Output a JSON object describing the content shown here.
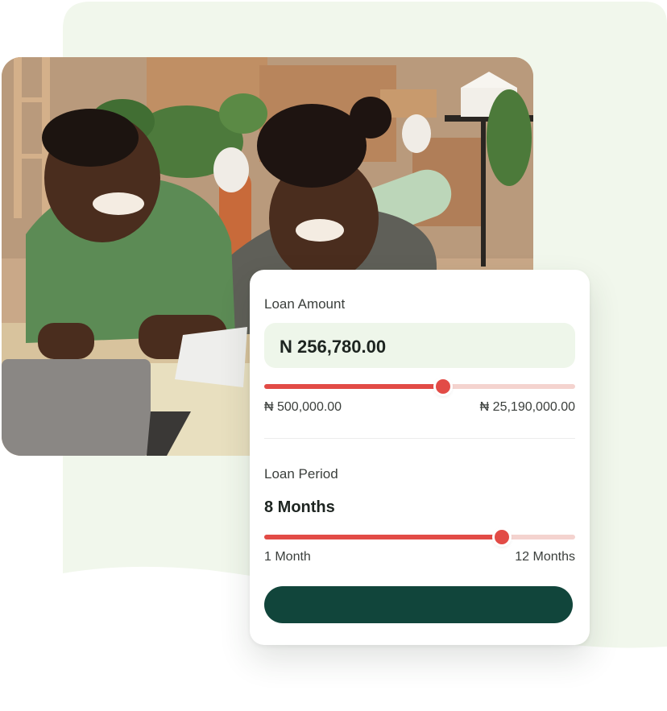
{
  "loan": {
    "amount_label": "Loan Amount",
    "amount_value": "N 256,780.00",
    "amount_slider": {
      "fraction": 0.575,
      "min_label": "₦ 500,000.00",
      "max_label": "₦ 25,190,000.00"
    },
    "period_label": "Loan Period",
    "period_value": "8 Months",
    "period_slider": {
      "fraction": 0.765,
      "min_label": "1 Month",
      "max_label": "12 Months"
    },
    "cta_label": ""
  },
  "colors": {
    "accent": "#e24b46",
    "accent_light": "#f4d3cf",
    "button": "#11453b",
    "panel_bg": "#eef6ea",
    "backdrop": "#f1f7ec"
  }
}
